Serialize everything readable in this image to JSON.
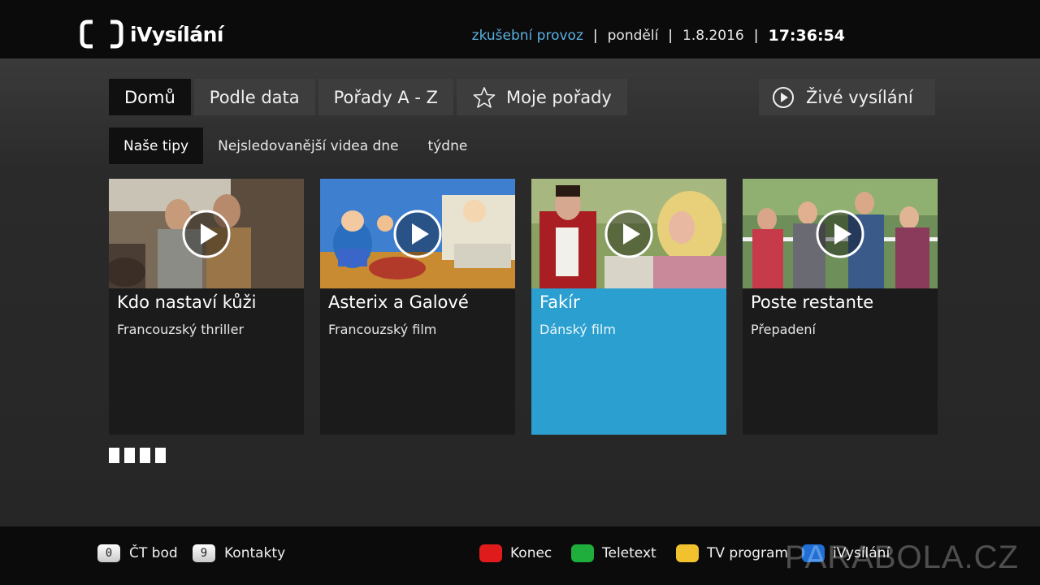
{
  "header": {
    "logo_text": "iVysílání",
    "trial_text": "zkušební provoz",
    "separator": "|",
    "day": "pondělí",
    "date": "1.8.2016",
    "time": "17:36:54"
  },
  "main_tabs": [
    {
      "label": "Domů",
      "active": true
    },
    {
      "label": "Podle data",
      "active": false
    },
    {
      "label": "Pořady A - Z",
      "active": false
    },
    {
      "label": "Moje pořady",
      "active": false,
      "icon": "star-icon"
    }
  ],
  "live_button": {
    "label": "Živé vysílání",
    "icon": "play-circle-icon"
  },
  "sub_tabs": [
    {
      "label": "Naše tipy",
      "active": true
    },
    {
      "label": "Nejsledovanější videa dne",
      "active": false
    },
    {
      "label": "týdne",
      "active": false
    }
  ],
  "cards": [
    {
      "title": "Kdo nastaví kůži",
      "subtitle": "Francouzský thriller",
      "selected": false
    },
    {
      "title": "Asterix a Galové",
      "subtitle": "Francouzský film",
      "selected": false
    },
    {
      "title": "Fakír",
      "subtitle": "Dánský film",
      "selected": true,
      "highlight_color": "#2a9fd0"
    },
    {
      "title": "Poste restante",
      "subtitle": "Přepadení",
      "selected": false
    }
  ],
  "pager": {
    "count": 4
  },
  "footer": {
    "keys": [
      {
        "key": "0",
        "label": "ČT bod"
      },
      {
        "key": "9",
        "label": "Kontakty"
      }
    ],
    "color_keys": [
      {
        "color": "#e01b1b",
        "label": "Konec"
      },
      {
        "color": "#1fae3c",
        "label": "Teletext"
      },
      {
        "color": "#f2c12e",
        "label": "TV program"
      },
      {
        "color": "#1f6fd6",
        "label": "iVysílání"
      }
    ],
    "watermark": "PARABOLA.CZ"
  },
  "colors": {
    "accent_blue": "#2a9fd0",
    "trial_text": "#5ab0e0",
    "bar_background": "#0b0b0b"
  }
}
